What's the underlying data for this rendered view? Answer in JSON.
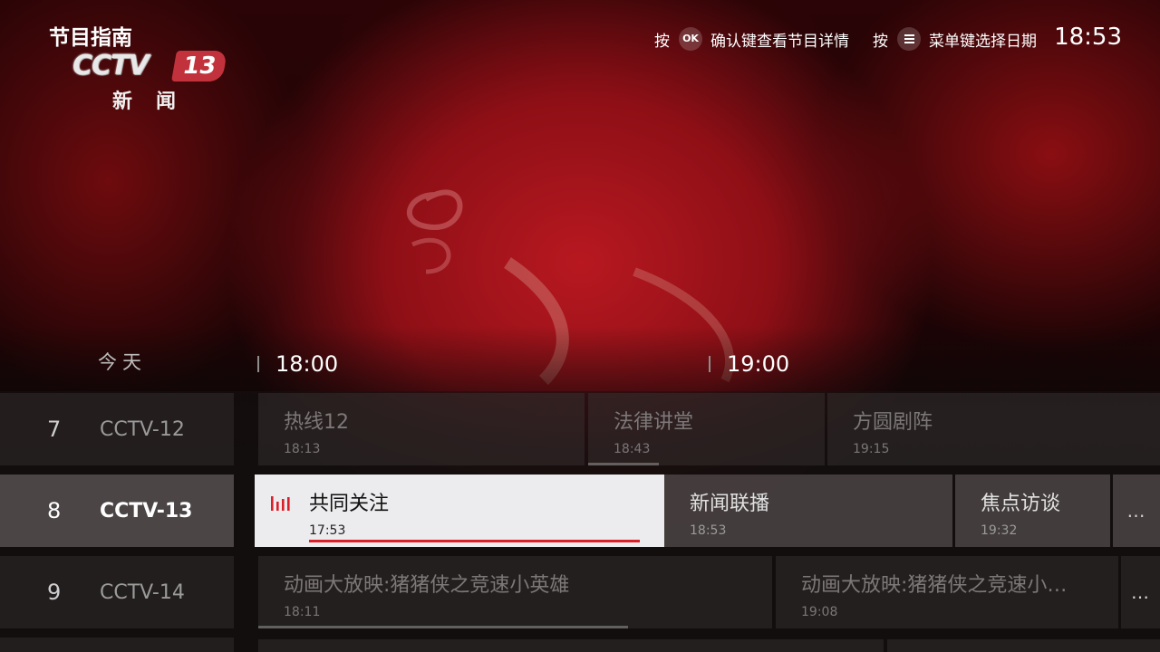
{
  "header": {
    "page_title": "节目指南",
    "logo": {
      "brand": "CCTV",
      "number": "13",
      "sub": "新闻"
    },
    "hints": [
      {
        "prefix": "按",
        "key": "OK",
        "text": "确认键查看节目详情"
      },
      {
        "prefix": "按",
        "key_icon": "menu-icon",
        "text": "菜单键选择日期"
      }
    ],
    "clock": "18:53"
  },
  "timeline": {
    "date_label": "今天",
    "ticks": [
      "18:00",
      "19:00"
    ]
  },
  "channels": [
    {
      "number": "7",
      "name": "CCTV-12",
      "selected": false,
      "programs": [
        {
          "title": "热线12",
          "time": "18:13"
        },
        {
          "title": "法律讲堂",
          "time": "18:43",
          "progress": 0.3
        },
        {
          "title": "方圆剧阵",
          "time": "19:15"
        }
      ]
    },
    {
      "number": "8",
      "name": "CCTV-13",
      "selected": true,
      "programs": [
        {
          "title": "共同关注",
          "time": "17:53",
          "focused": true,
          "playing": true,
          "progress": 1.0
        },
        {
          "title": "新闻联播",
          "time": "18:53"
        },
        {
          "title": "焦点访谈",
          "time": "19:32"
        },
        {
          "title": "…"
        }
      ]
    },
    {
      "number": "9",
      "name": "CCTV-14",
      "selected": false,
      "programs": [
        {
          "title": "动画大放映:猪猪侠之竞速小英雄",
          "time": "18:11",
          "progress": 0.72
        },
        {
          "title": "动画大放映:猪猪侠之竞速小…",
          "time": "19:08"
        },
        {
          "title": "…"
        }
      ]
    }
  ],
  "colors": {
    "accent_red": "#d9202a",
    "focus_bg": "#ecebed",
    "logo_red": "#c2323c"
  }
}
